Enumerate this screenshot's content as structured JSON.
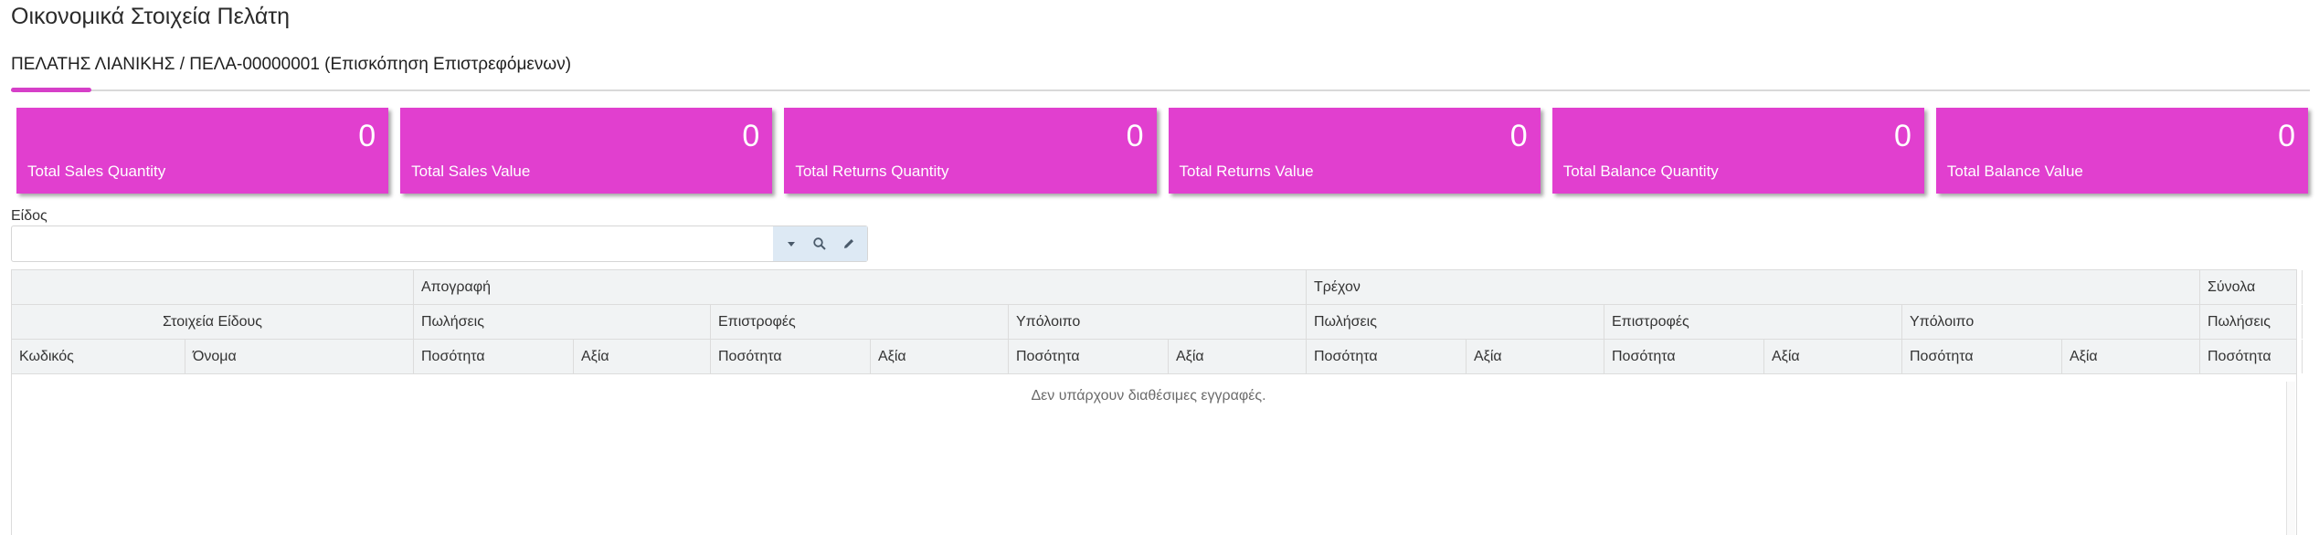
{
  "page": {
    "title": "Οικονομικά Στοιχεία Πελάτη"
  },
  "tab": {
    "label": "ΠΕΛΑΤΗΣ ΛΙΑΝΙΚΗΣ / ΠΕΛΑ-00000001 (Επισκόπηση Επιστρεφόμενων)",
    "accent_color": "#d63fc8"
  },
  "cards": [
    {
      "value": "0",
      "label": "Total Sales Quantity"
    },
    {
      "value": "0",
      "label": "Total Sales Value"
    },
    {
      "value": "0",
      "label": "Total Returns Quantity"
    },
    {
      "value": "0",
      "label": "Total Returns Value"
    },
    {
      "value": "0",
      "label": "Total Balance Quantity"
    },
    {
      "value": "0",
      "label": "Total Balance Value"
    }
  ],
  "card_color": "#e13fcf",
  "item_filter": {
    "label": "Είδος",
    "value": "",
    "icons": [
      "chevron-down-icon",
      "search-icon",
      "pencil-icon"
    ]
  },
  "grid": {
    "group_row_1": [
      "",
      "Απογραφή",
      "Τρέχον",
      "Σύνολα"
    ],
    "group_row_2": [
      "Στοιχεία Είδους",
      "Πωλήσεις",
      "Επιστροφές",
      "Υπόλοιπο",
      "Πωλήσεις",
      "Επιστροφές",
      "Υπόλοιπο",
      "Πωλήσεις"
    ],
    "columns": [
      "Κωδικός",
      "Όνομα",
      "Ποσότητα",
      "Αξία",
      "Ποσότητα",
      "Αξία",
      "Ποσότητα",
      "Αξία",
      "Ποσότητα",
      "Αξία",
      "Ποσότητα",
      "Αξία",
      "Ποσότητα",
      "Αξία",
      "Ποσότητα"
    ],
    "empty_message": "Δεν υπάρχουν διαθέσιμες εγγραφές."
  }
}
